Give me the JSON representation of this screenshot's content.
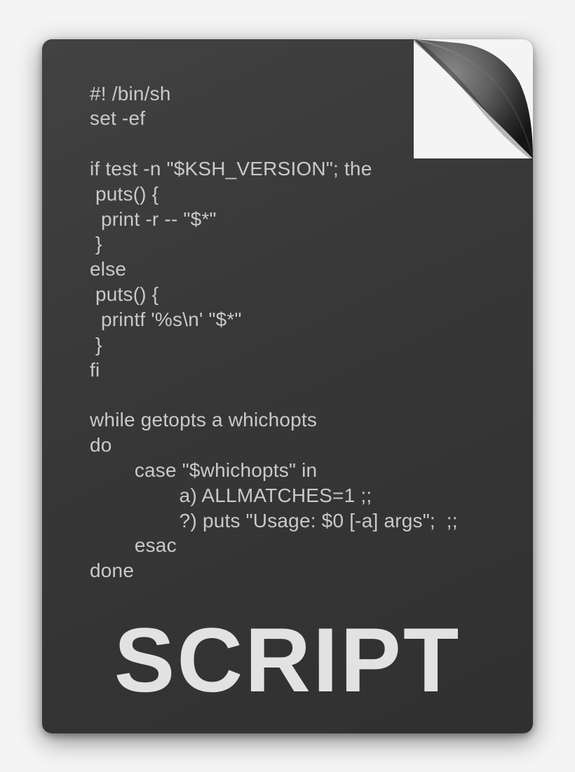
{
  "code_lines": [
    "#! /bin/sh",
    "set -ef",
    "",
    "if test -n \"$KSH_VERSION\"; the",
    " puts() {",
    "  print -r -- \"$*\"",
    " }",
    "else",
    " puts() {",
    "  printf '%s\\n' \"$*\"",
    " }",
    "fi",
    "",
    "while getopts a whichopts",
    "do",
    "        case \"$whichopts\" in",
    "                a) ALLMATCHES=1 ;;",
    "                ?) puts \"Usage: $0 [-a] args\";  ;;",
    "        esac",
    "done"
  ],
  "label": "SCRIPT"
}
